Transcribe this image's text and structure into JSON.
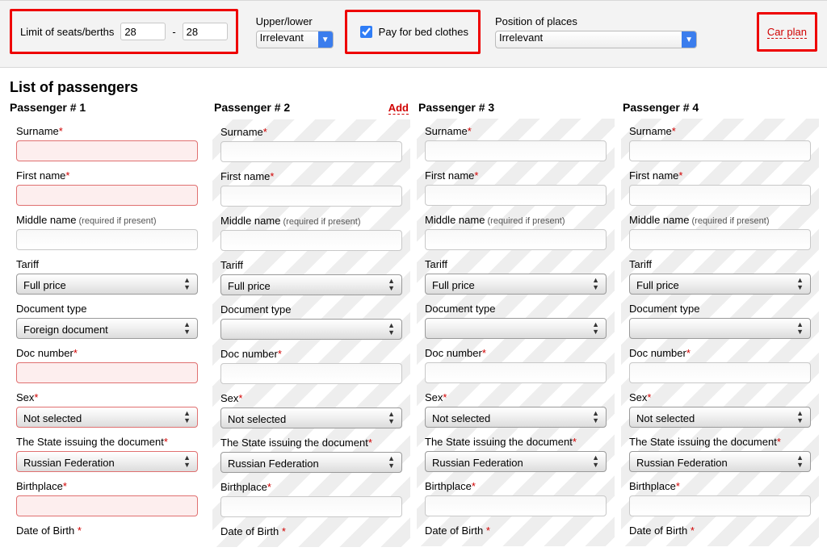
{
  "top": {
    "limit_label": "Limit of seats/berths",
    "limit_from": "28",
    "limit_to": "28",
    "upper_lower_label": "Upper/lower",
    "upper_lower_value": "Irrelevant",
    "pay_label": "Pay for bed clothes",
    "pay_checked": true,
    "position_label": "Position of places",
    "position_value": "Irrelevant",
    "carplan_label": "Car plan"
  },
  "section_title": "List of passengers",
  "add_label": "Add",
  "labels": {
    "surname": "Surname",
    "first_name": "First name",
    "middle_name": "Middle name",
    "middle_hint": "(required if present)",
    "tariff": "Tariff",
    "doc_type": "Document type",
    "doc_number": "Doc number",
    "sex": "Sex",
    "issuing_state": "The State issuing the document",
    "birthplace": "Birthplace",
    "dob": "Date of Birth"
  },
  "options": {
    "tariff": "Full price",
    "sex": "Not selected",
    "state": "Russian Federation"
  },
  "passengers": [
    {
      "title": "Passenger # 1",
      "doc_type": "Foreign document",
      "has_add": false,
      "err": true
    },
    {
      "title": "Passenger # 2",
      "doc_type": "",
      "has_add": true,
      "err": false
    },
    {
      "title": "Passenger # 3",
      "doc_type": "",
      "has_add": false,
      "err": false
    },
    {
      "title": "Passenger # 4",
      "doc_type": "",
      "has_add": false,
      "err": false
    }
  ]
}
